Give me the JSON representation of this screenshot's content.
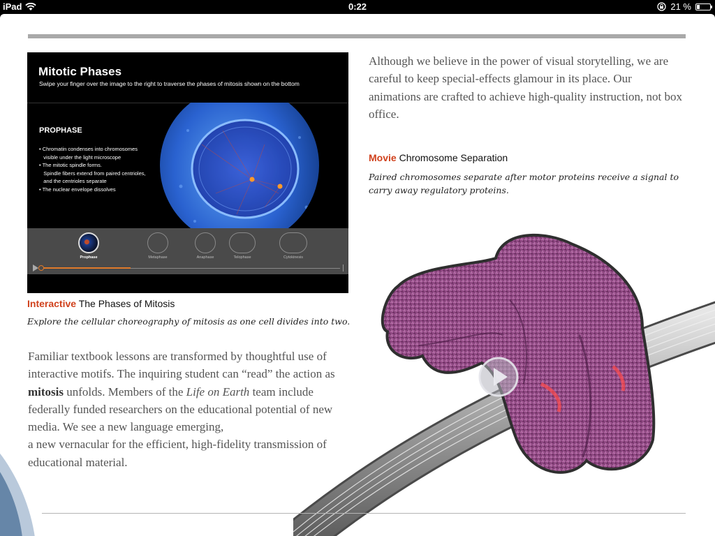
{
  "statusbar": {
    "device": "iPad",
    "time": "0:22",
    "battery_text": "21 %",
    "battery_level": 0.21
  },
  "figure": {
    "title": "Mitotic Phases",
    "subtitle": "Swipe your finger over the image to the right to traverse the phases of mitosis shown on the bottom",
    "phase_name": "PROPHASE",
    "phase_points": [
      "• Chromatin condenses into chromosomes",
      "   visible under the light microscope",
      "• The mitotic spindle forms.",
      "   Spindle fibers extend from paired centrioles,",
      "   and the centrioles separate",
      "• The nuclear envelope dissolves"
    ],
    "phases": [
      {
        "label": "Prophase",
        "active": true
      },
      {
        "label": "Metaphase",
        "active": false
      },
      {
        "label": "Anaphase",
        "active": false
      },
      {
        "label": "Telophase",
        "active": false
      },
      {
        "label": "Cytokinesis",
        "active": false
      }
    ],
    "scrub_progress": 0.3
  },
  "interactive_caption": {
    "keyword": "Interactive",
    "title": "The Phases of Mitosis",
    "body": "Explore the cellular choreography of mitosis as one cell divides into two."
  },
  "left_paragraph": {
    "part1": "Familiar textbook lessons are transformed by thoughtful use of interactive motifs. The inquiring student can “read” the action as ",
    "bold": "mitosis",
    "part2": " unfolds. Members of the ",
    "italic": "Life on Earth",
    "part3": " team include federally funded researchers on the educational potential of new media. We see a new language emerging,",
    "part4": "a new vernacular for the efficient, high-fidelity transmission of educational material."
  },
  "right_paragraph": "Although we believe in the power of visual storytelling, we are careful to keep special-effects glamour in its place. Our animations are crafted to achieve high-quality instruction, not box office.",
  "movie_caption": {
    "keyword": "Movie",
    "title": "Chromosome Separation",
    "body": "Paired chromosomes separate after motor proteins receive a signal to carry away regulatory proteins."
  },
  "colors": {
    "accent": "#d0411c",
    "rule": "#a9a9a9",
    "body_text": "#555555",
    "chromosome": "#9c4f8e"
  }
}
